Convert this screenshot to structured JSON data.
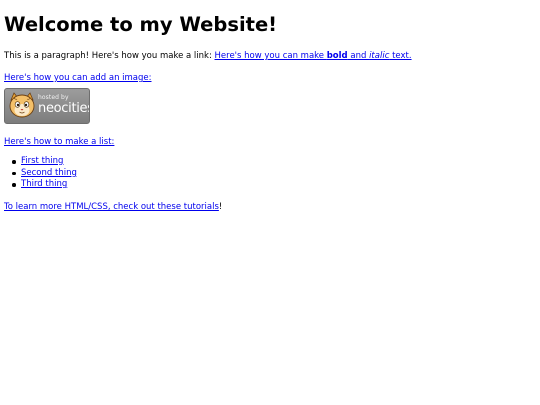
{
  "page": {
    "title": "Welcome to my Website!"
  },
  "intro": {
    "prefix": "This is a paragraph! Here's how you make a link: ",
    "link_start": "Here's how you can make ",
    "link_bold": "bold",
    "link_mid": " and ",
    "link_italic": "italic",
    "link_end": " text."
  },
  "image_section": {
    "link_text": "Here's how you can add an image:",
    "badge": {
      "hosted_by": "hosted by",
      "name": "neocities",
      "icon": "neocities-cat-icon",
      "bg_color": "#8a8a8a"
    }
  },
  "list_section": {
    "link_text": "Here's how to make a list:",
    "items": [
      "First thing",
      "Second thing",
      "Third thing"
    ]
  },
  "tutorials": {
    "link_text": "To learn more HTML/CSS, check out these tutorials",
    "suffix": "!"
  },
  "colors": {
    "link": "#0000ee",
    "text": "#000000",
    "background": "#ffffff"
  }
}
